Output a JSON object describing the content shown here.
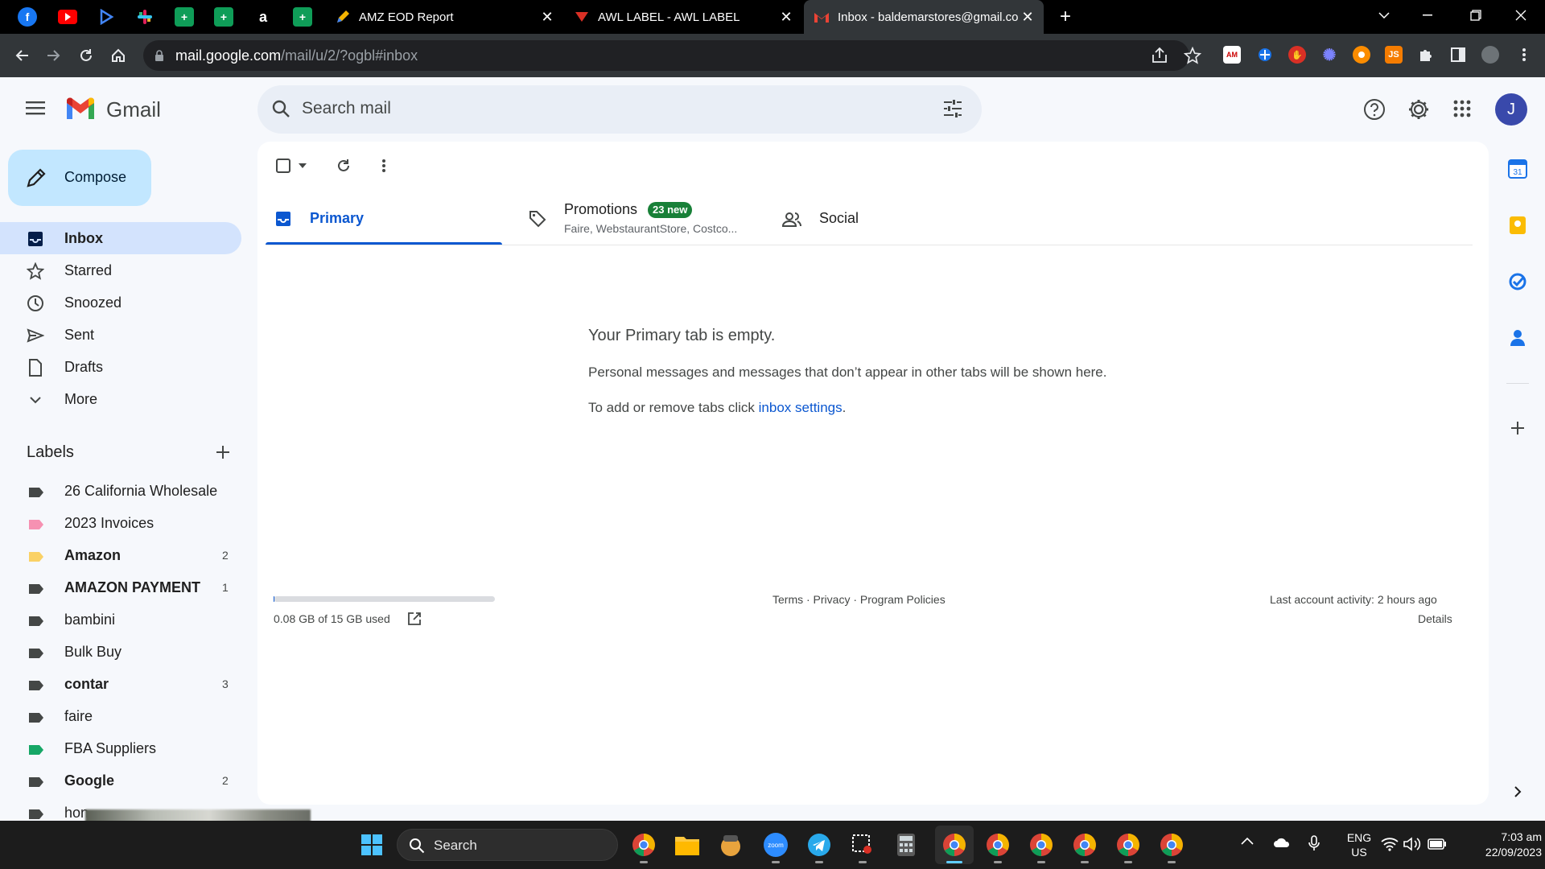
{
  "browser": {
    "pinned_tabs": [
      "facebook-icon",
      "youtube-icon",
      "play-icon",
      "slack-icon",
      "sheets-icon",
      "sheets-icon",
      "amazon-icon",
      "sheets-icon"
    ],
    "tabs": [
      {
        "title": "AMZ EOD Report",
        "active": false
      },
      {
        "title": "AWL LABEL - AWL LABEL",
        "active": false
      },
      {
        "title": "Inbox - baldemarstores@gmail.com",
        "active": true
      }
    ],
    "url_host": "mail.google.com",
    "url_rest": "/mail/u/2/?ogbl#inbox"
  },
  "gmail": {
    "logo_text": "Gmail",
    "search_placeholder": "Search mail",
    "avatar_letter": "J",
    "compose_label": "Compose",
    "nav": [
      {
        "label": "Inbox",
        "icon": "inbox-icon",
        "active": true
      },
      {
        "label": "Starred",
        "icon": "star-icon"
      },
      {
        "label": "Snoozed",
        "icon": "clock-icon"
      },
      {
        "label": "Sent",
        "icon": "send-icon"
      },
      {
        "label": "Drafts",
        "icon": "draft-icon"
      },
      {
        "label": "More",
        "icon": "chevron-down-icon"
      }
    ],
    "labels_heading": "Labels",
    "labels": [
      {
        "name": "26 California Wholesale",
        "color": "#444746",
        "count": "",
        "bold": false
      },
      {
        "name": "2023 Invoices",
        "color": "#f691b2",
        "count": "",
        "bold": false
      },
      {
        "name": "Amazon",
        "color": "#fad165",
        "count": "2",
        "bold": true
      },
      {
        "name": "AMAZON PAYMENT",
        "color": "#444746",
        "count": "1",
        "bold": true
      },
      {
        "name": "bambini",
        "color": "#444746",
        "count": "",
        "bold": false
      },
      {
        "name": "Bulk Buy",
        "color": "#444746",
        "count": "",
        "bold": false
      },
      {
        "name": "contar",
        "color": "#444746",
        "count": "3",
        "bold": true
      },
      {
        "name": "faire",
        "color": "#444746",
        "count": "",
        "bold": false
      },
      {
        "name": "FBA Suppliers",
        "color": "#16a766",
        "count": "",
        "bold": false
      },
      {
        "name": "Google",
        "color": "#444746",
        "count": "2",
        "bold": true
      },
      {
        "name": "hon",
        "color": "#444746",
        "count": "",
        "bold": false
      }
    ],
    "tabs": {
      "primary": "Primary",
      "promotions": "Promotions",
      "promotions_badge": "23 new",
      "promotions_senders": "Faire, WebstaurantStore, Costco...",
      "social": "Social"
    },
    "empty": {
      "title": "Your Primary tab is empty.",
      "desc": "Personal messages and messages that don’t appear in other tabs will be shown here.",
      "add_prefix": "To add or remove tabs click ",
      "add_link": "inbox settings",
      "add_suffix": "."
    },
    "footer": {
      "storage": "0.08 GB of 15 GB used",
      "storage_fraction": 0.005,
      "links": "Terms · Privacy · Program Policies",
      "activity": "Last account activity: 2 hours ago",
      "details": "Details"
    }
  },
  "taskbar": {
    "search_label": "Search",
    "lang_top": "ENG",
    "lang_bottom": "US",
    "time": "7:03 am",
    "date": "22/09/2023"
  },
  "colors": {
    "accent": "#0b57d0",
    "compose_bg": "#c2e7ff",
    "active_nav": "#d3e3fd"
  }
}
